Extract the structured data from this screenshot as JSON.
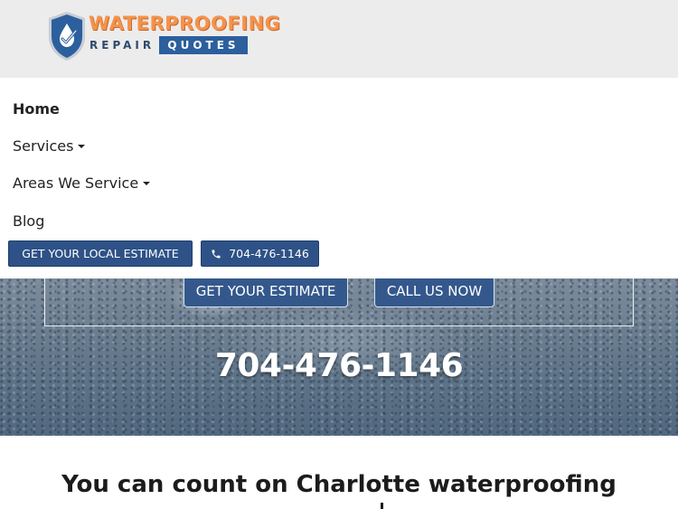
{
  "header": {
    "logo": {
      "line1": "WATERPROOFING",
      "line2": "REPAIR",
      "line3": "QUOTES",
      "colors": {
        "orange": "#f5924a",
        "navy": "#2f4a6d",
        "blue": "#2c5f9e"
      },
      "icon": "shield-check-icon"
    }
  },
  "nav": {
    "items": [
      {
        "label": "Home",
        "active": true,
        "dropdown": false
      },
      {
        "label": "Services",
        "active": false,
        "dropdown": true
      },
      {
        "label": "Areas We Service",
        "active": false,
        "dropdown": true
      },
      {
        "label": "Blog",
        "active": false,
        "dropdown": false
      }
    ],
    "buttons": {
      "estimate_label": "GET YOUR LOCAL ESTIMATE",
      "phone_label": "704-476-1146",
      "phone_icon": "phone-icon"
    }
  },
  "hero": {
    "estimate_button": "GET YOUR ESTIMATE",
    "call_button": "CALL US NOW",
    "phone": "704-476-1146"
  },
  "content": {
    "heading": "You can count on Charlotte waterproofing"
  },
  "colors": {
    "button_blue": "#2e5287",
    "header_bg": "#ececec"
  }
}
